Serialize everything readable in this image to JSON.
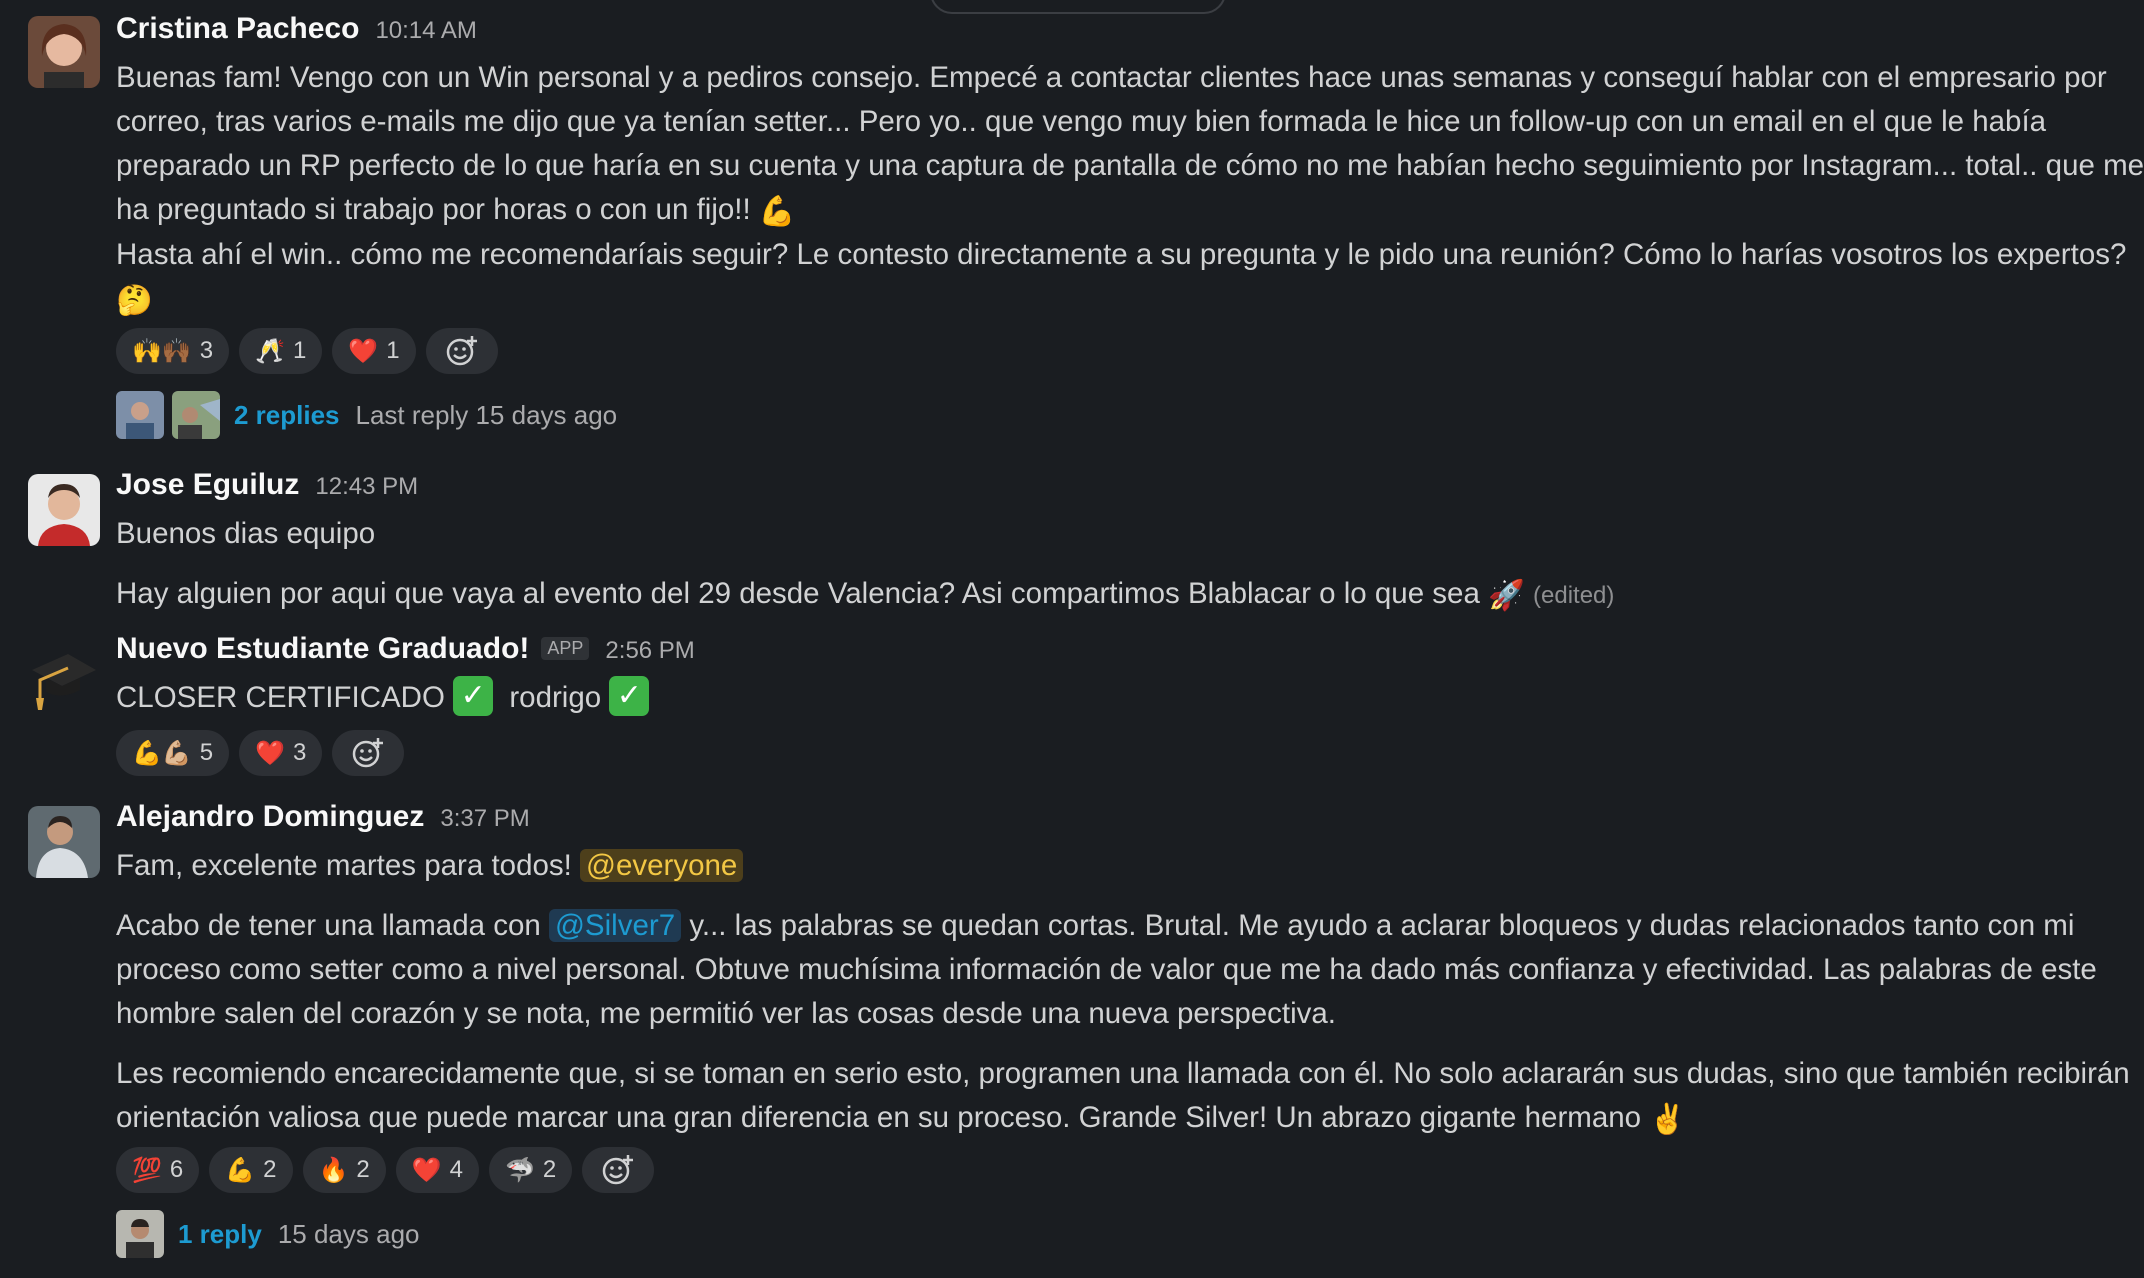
{
  "messages": [
    {
      "author": "Cristina Pacheco",
      "time": "10:14 AM",
      "lines": [
        "Buenas fam! Vengo con un Win personal y a pediros consejo. Empecé a contactar clientes hace unas semanas y conseguí hablar con el empresario por",
        "correo, tras varios e-mails me dijo que ya tenían setter... Pero yo.. que vengo muy bien formada le hice un follow-up con un email en el que le había",
        "preparado un RP perfecto de lo que haría en su cuenta y una captura de pantalla de cómo no me habían hecho seguimiento por Instagram... total.. que me",
        "ha preguntado si trabajo por horas o con un fijo!!",
        "Hasta ahí el win.. cómo me recomendaríais seguir? Le contesto directamente a su pregunta y le pido una reunión? Cómo lo harías vosotros los expertos?"
      ],
      "emoji_muscle": "💪",
      "emoji_thinking": "🤔",
      "reactions": [
        {
          "emoji": "🙌🙌🏾",
          "count": "3"
        },
        {
          "emoji": "🥂",
          "count": "1"
        },
        {
          "emoji": "❤️",
          "count": "1"
        }
      ],
      "thread": {
        "replies": "2 replies",
        "last": "Last reply 15 days ago"
      }
    },
    {
      "author": "Jose Eguiluz",
      "time": "12:43 PM",
      "line1": "Buenos dias equipo",
      "line2": "Hay alguien por aqui que vaya al evento del 29 desde Valencia? Asi compartimos Blablacar o lo que sea",
      "emoji_rocket": "🚀",
      "edited": "(edited)"
    },
    {
      "author": "Nuevo Estudiante Graduado!",
      "badge": "APP",
      "time": "2:56 PM",
      "text_a": "CLOSER CERTIFICADO",
      "text_b": "rodrigo",
      "check": "✓",
      "avatar_emoji": "🎓",
      "reactions": [
        {
          "emoji": "💪💪🏼",
          "count": "5"
        },
        {
          "emoji": "❤️",
          "count": "3"
        }
      ]
    },
    {
      "author": "Alejandro Dominguez",
      "time": "3:37 PM",
      "line1": "Fam, excelente martes para todos!",
      "mention_everyone": "@everyone",
      "p2_pre": "Acabo de tener una llamada con",
      "mention_user": "@Silver7",
      "p2_post": "y... las palabras se quedan cortas. Brutal. Me ayudo a aclarar bloqueos y dudas relacionados tanto con mi",
      "p2_line2": "proceso como setter como a nivel personal. Obtuve muchísima información de valor que me ha dado más confianza y efectividad. Las palabras de este",
      "p2_line3": "hombre salen del corazón y se nota, me permitió ver las cosas desde una nueva perspectiva.",
      "p3_line1": "Les recomiendo encarecidamente que, si se toman en serio esto, programen una llamada con él. No solo aclararán sus dudas, sino que también recibirán",
      "p3_line2": "orientación valiosa que puede marcar una gran diferencia en su proceso. Grande Silver! Un abrazo gigante hermano",
      "emoji_victory": "✌️",
      "reactions": [
        {
          "emoji": "💯",
          "count": "6"
        },
        {
          "emoji": "💪",
          "count": "2"
        },
        {
          "emoji": "🔥",
          "count": "2"
        },
        {
          "emoji": "❤️",
          "count": "4"
        },
        {
          "emoji": "🦈",
          "count": "2"
        }
      ],
      "thread": {
        "replies": "1 reply",
        "last": "15 days ago"
      }
    }
  ],
  "colors": {
    "background": "#1a1d21",
    "link": "#1d9bd1",
    "mention_everyone": "#f2c744",
    "reaction_bg": "#2d3035",
    "check_green": "#3db347"
  }
}
